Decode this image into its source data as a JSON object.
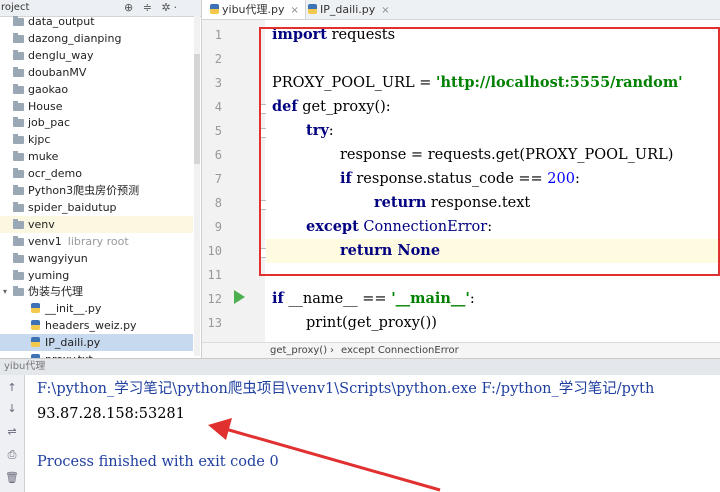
{
  "project_panel": {
    "title": "roject",
    "header_icons": "⊕ ≑ ✲·",
    "items": [
      {
        "label": "data_output",
        "type": "folder"
      },
      {
        "label": "dazong_dianping",
        "type": "folder"
      },
      {
        "label": "denglu_way",
        "type": "folder"
      },
      {
        "label": "doubanMV",
        "type": "folder"
      },
      {
        "label": "gaokao",
        "type": "folder"
      },
      {
        "label": "House",
        "type": "folder"
      },
      {
        "label": "job_pac",
        "type": "folder"
      },
      {
        "label": "kjpc",
        "type": "folder"
      },
      {
        "label": "muke",
        "type": "folder"
      },
      {
        "label": "ocr_demo",
        "type": "folder"
      },
      {
        "label": "Python3爬虫房价预测",
        "type": "folder"
      },
      {
        "label": "spider_baidutup",
        "type": "folder"
      },
      {
        "label": "venv",
        "type": "folder",
        "state": "excluded"
      },
      {
        "label": "venv1",
        "type": "folder",
        "extra": "library root"
      },
      {
        "label": "wangyiyun",
        "type": "folder"
      },
      {
        "label": "yuming",
        "type": "folder"
      },
      {
        "label": "伪装与代理",
        "type": "folder",
        "expanded": "▾"
      },
      {
        "label": "__init__.py",
        "type": "file"
      },
      {
        "label": "headers_weiz.py",
        "type": "file"
      },
      {
        "label": "IP_daili.py",
        "type": "file",
        "state": "selected"
      },
      {
        "label": "proxy.txt",
        "type": "file"
      }
    ]
  },
  "editor": {
    "tabs": [
      {
        "label": "yibu代理.py",
        "close": "×",
        "active": true
      },
      {
        "label": "IP_daili.py",
        "close": "×",
        "active": false
      }
    ],
    "line_numbers": [
      "1",
      "2",
      "3",
      "4",
      "5",
      "6",
      "7",
      "8",
      "9",
      "10",
      "11",
      "12",
      "13"
    ],
    "code": {
      "l1_kw": "import",
      "l1_rest": " requests",
      "l3_a": "PROXY_POOL_URL = ",
      "l3_str": "'http://localhost:5555/random'",
      "l4_kw": "def",
      "l4_rest": " get_proxy():",
      "l5_kw": "try",
      "l5_rest": ":",
      "l6": "response = requests.get(PROXY_POOL_URL)",
      "l7_kw": "if",
      "l7_mid": " response.status_code == ",
      "l7_num": "200",
      "l7_end": ":",
      "l8_kw": "return",
      "l8_rest": " response.text",
      "l9_kw": "except",
      "l9_cls": " ConnectionError",
      "l9_end": ":",
      "l10_kw": "return",
      "l10_kw2": " None",
      "l12_kw": "if",
      "l12_a": " __name__ == ",
      "l12_str": "'__main__'",
      "l12_end": ":",
      "l13": "print(get_proxy())"
    },
    "breadcrumb": [
      "get_proxy()",
      "›",
      "except ConnectionError"
    ]
  },
  "run_panel": {
    "header": "yibu代理",
    "side_icons": [
      "↑",
      "↓",
      "⇌",
      "⎙",
      "🗑"
    ],
    "console": [
      "F:\\python_学习笔记\\python爬虫项目\\venv1\\Scripts\\python.exe F:/python_学习笔记/pyth",
      "93.87.28.158:53281",
      "",
      "Process finished with exit code 0"
    ]
  },
  "colors": {
    "highlight_box": "#e03030",
    "annotation_arrow": "#e03030",
    "keyword": "#000080",
    "string": "#008000"
  }
}
